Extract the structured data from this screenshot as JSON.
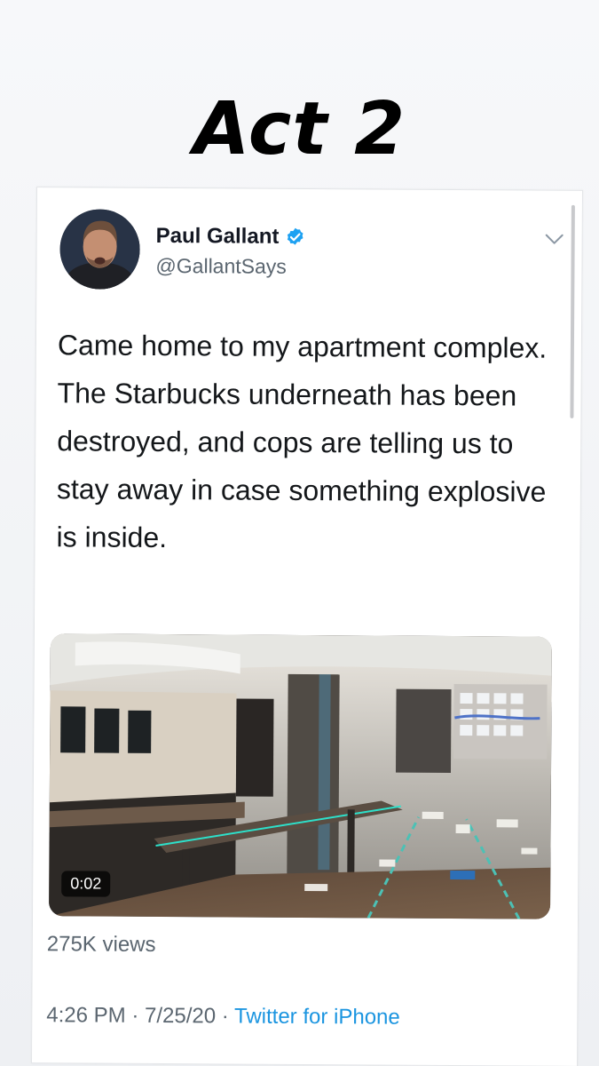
{
  "header": {
    "title": "Act 2"
  },
  "tweet": {
    "author": {
      "name": "Paul Gallant",
      "handle": "@GallantSays",
      "verified": true
    },
    "text": "Came home to my apartment complex. The Starbucks underneath has been destroyed, and cops are telling us to stay away in case something explosive is inside.",
    "media": {
      "type": "video",
      "duration": "0:02"
    },
    "views": "275K views",
    "time": "4:26 PM",
    "separator": "·",
    "date": "7/25/20",
    "source": "Twitter for iPhone"
  },
  "colors": {
    "verified_badge": "#1da1f2",
    "link": "#1b95e0",
    "secondary_text": "#5b6670"
  },
  "icons": {
    "verified": "verified-badge-icon",
    "more": "chevron-down-icon"
  }
}
